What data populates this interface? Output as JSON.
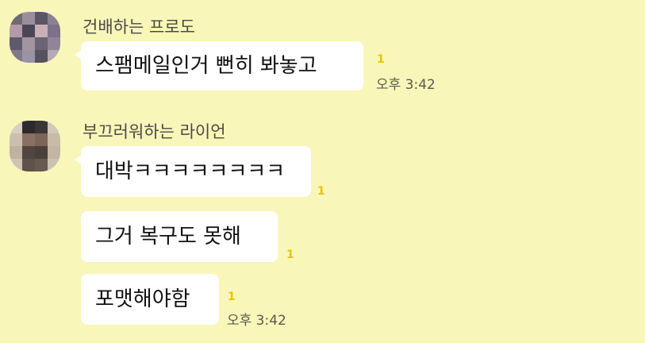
{
  "messages": [
    {
      "sender": "건배하는 프로도",
      "avatar_colors": [
        "#6e6a78",
        "#9c8f9c",
        "#5b5666",
        "#8a8294",
        "#b39aa8",
        "#4b4656",
        "#c7b0b6",
        "#7c7288",
        "#5e5a6c",
        "#a3949f",
        "#6c6374",
        "#8f8596",
        "#7f7a89",
        "#9a93a5",
        "#56505f",
        "#b7a9b3"
      ],
      "bubbles": [
        {
          "text": "스팸메일인거 뻔히 봐놓고",
          "unread": "1",
          "time": "오후 3:42"
        }
      ]
    },
    {
      "sender": "부끄러워하는 라이언",
      "avatar_colors": [
        "#d9cfc2",
        "#2d2a2c",
        "#3a3537",
        "#d2c7b8",
        "#cbbfae",
        "#8a6f63",
        "#7d6457",
        "#c8bba8",
        "#bfb2a0",
        "#51463f",
        "#4a403a",
        "#c2b5a2",
        "#cfc4b3",
        "#5e524b",
        "#675a50",
        "#cdc1b0"
      ],
      "bubbles": [
        {
          "text": "대박ㅋㅋㅋㅋㅋㅋㅋㅋ",
          "unread": "1",
          "time": ""
        },
        {
          "text": "그거 복구도 못해",
          "unread": "1",
          "time": ""
        },
        {
          "text": "포맷해야함",
          "unread": "1",
          "time": "오후 3:42"
        }
      ]
    }
  ]
}
